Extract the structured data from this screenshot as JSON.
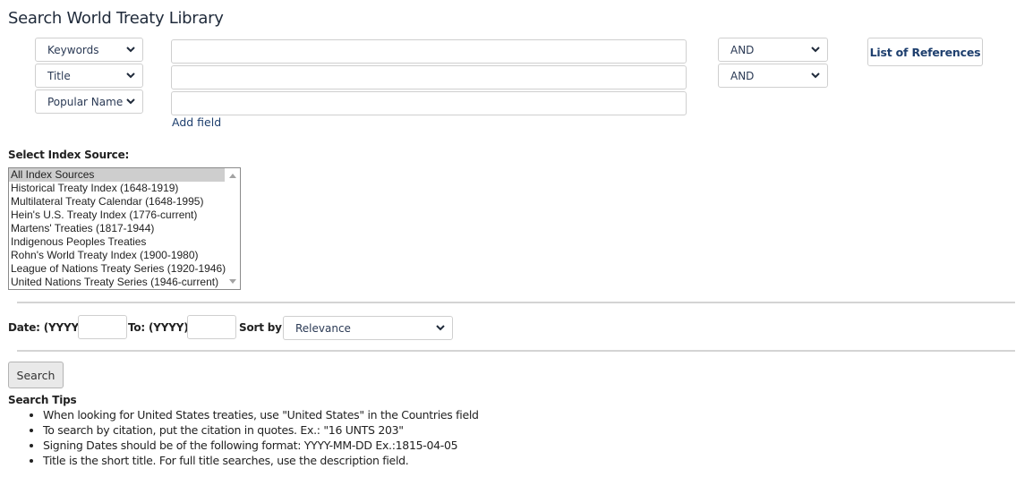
{
  "page": {
    "title": "Search World Treaty Library"
  },
  "search_rows": [
    {
      "field": "Keywords",
      "value": "",
      "operator": "AND"
    },
    {
      "field": "Title",
      "value": "",
      "operator": "AND"
    },
    {
      "field": "Popular Name",
      "value": ""
    }
  ],
  "add_field_label": "Add field",
  "list_of_references_label": "List of References",
  "index_source": {
    "label": "Select Index Source:",
    "options": [
      "All Index Sources",
      "Historical Treaty Index (1648-1919)",
      "Multilateral Treaty Calendar (1648-1995)",
      "Hein's U.S. Treaty Index (1776-current)",
      "Martens' Treaties (1817-1944)",
      "Indigenous Peoples Treaties",
      "Rohn's World Treaty Index (1900-1980)",
      "League of Nations Treaty Series (1920-1946)",
      "United Nations Treaty Series (1946-current)"
    ],
    "selected": "All Index Sources"
  },
  "date_filter": {
    "from_label": "Date: (YYYY)",
    "from_value": "",
    "to_label": "To: (YYYY)",
    "to_value": "",
    "sort_label": "Sort by:",
    "sort_value": "Relevance"
  },
  "search_button_label": "Search",
  "tips": {
    "heading": "Search Tips",
    "items": [
      "When looking for United States treaties, use \"United States\" in the Countries field",
      "To search by citation, put the citation in quotes. Ex.: \"16 UNTS 203\"",
      "Signing Dates should be of the following format: YYYY-MM-DD Ex.:1815-04-05",
      "Title is the short title. For full title searches, use the description field."
    ]
  }
}
